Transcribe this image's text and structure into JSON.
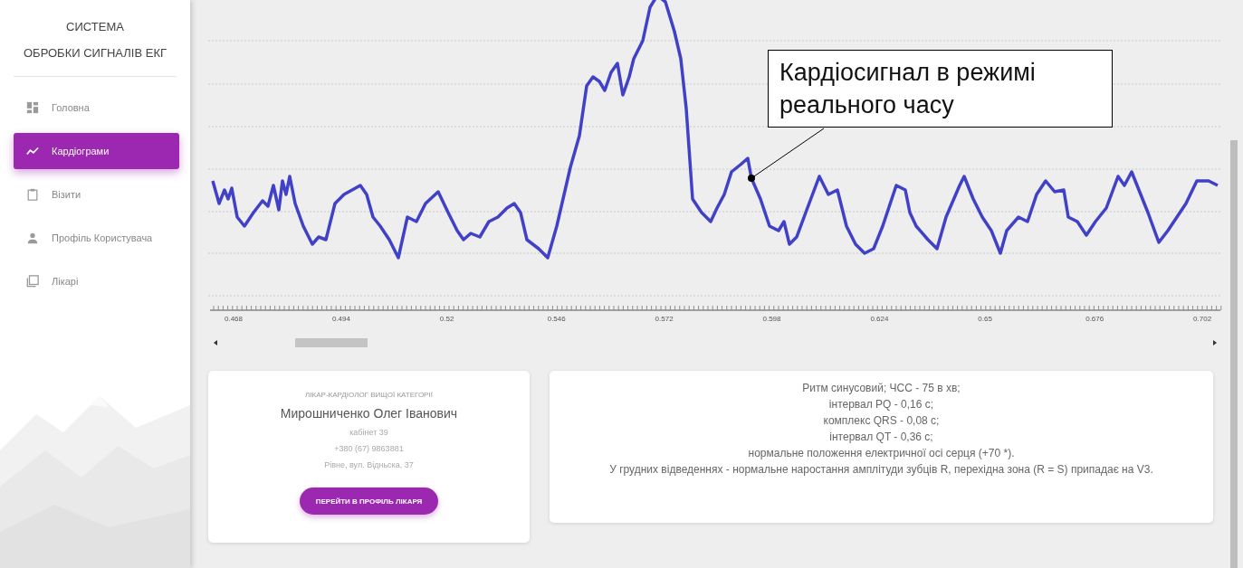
{
  "sidebar": {
    "title_lines": [
      "СИСТЕМА",
      "ОБРОБКИ СИГНАЛІВ ЕКГ"
    ],
    "items": [
      {
        "label": "Головна",
        "kind": "dashboard",
        "selected": false
      },
      {
        "label": "Кардіограми",
        "kind": "chart",
        "selected": true
      },
      {
        "label": "Візити",
        "kind": "clipboard",
        "selected": false
      },
      {
        "label": "Профіль Користувача",
        "kind": "person",
        "selected": false
      },
      {
        "label": "Лікарі",
        "kind": "library",
        "selected": false
      }
    ]
  },
  "ecg": {
    "callout": "Кардіосигнал в режимі реального часу",
    "x_tick_labels": [
      "0.468",
      "0.494",
      "0.52",
      "0.546",
      "0.572",
      "0.598",
      "0.624",
      "0.65",
      "0.676",
      "0.702"
    ]
  },
  "doctor": {
    "category": "ЛІКАР-КАРДІОЛОГ ВИЩОЇ КАТЕГОРІЇ",
    "name": "Мирошниченко Олег Іванович",
    "details": [
      "кабінет 39",
      "+380 (67) 9863881",
      "Рівне, вул. Відньска, 37"
    ],
    "button": "ПЕРЕЙТИ В ПРОФІЛЬ ЛІКАРЯ"
  },
  "report": {
    "lines": [
      "Ритм синусовий; ЧСС - 75 в хв;",
      "інтервал PQ - 0,16 с;",
      "комплекс QRS - 0,08 с;",
      "інтервал QT - 0,36 с;",
      "нормальне положення електричної осі серця (+70 *).",
      "У грудних відведеннях - нормальне наростання амплітуди зубців R, перехідна зона (R = S) припадає на V3."
    ]
  }
}
